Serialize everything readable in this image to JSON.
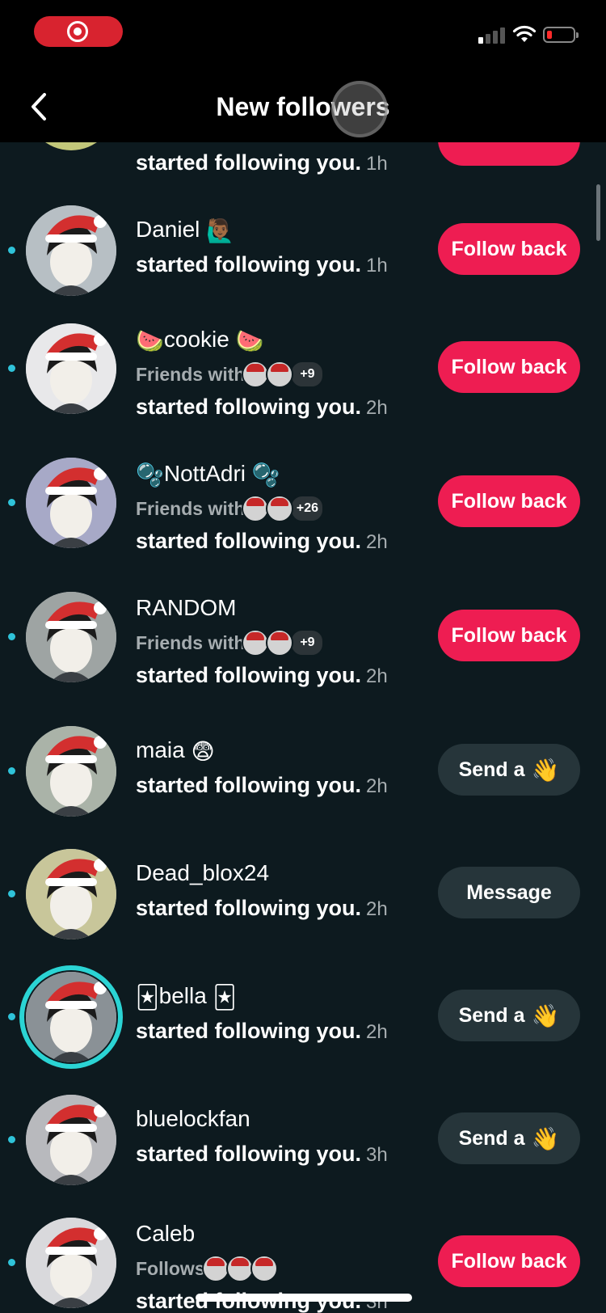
{
  "header": {
    "title": "New followers"
  },
  "partial_top": {
    "action": "started following you.",
    "time": "1h"
  },
  "rows": [
    {
      "name": "Daniel",
      "name_emoji_after": "🙋🏾‍♂️",
      "friends": null,
      "action": "started following you.",
      "time": "1h",
      "button": "Follow back",
      "button_style": "pink"
    },
    {
      "name": "cookie",
      "name_emoji_before": "🍉",
      "name_emoji_after": "🍉",
      "friends": {
        "label": "Friends with",
        "more": "+9"
      },
      "action": "started following you.",
      "time": "2h",
      "button": "Follow back",
      "button_style": "pink"
    },
    {
      "name": "NottAdri",
      "name_emoji_before": "🫧",
      "name_emoji_after": "🫧",
      "friends": {
        "label": "Friends with",
        "more": "+26"
      },
      "action": "started following you.",
      "time": "2h",
      "button": "Follow back",
      "button_style": "pink"
    },
    {
      "name": "RANDOM",
      "friends": {
        "label": "Friends with",
        "more": "+9"
      },
      "action": "started following you.",
      "time": "2h",
      "button": "Follow back",
      "button_style": "pink"
    },
    {
      "name": "maia",
      "name_emoji_after": "😨",
      "friends": null,
      "action": "started following you.",
      "time": "2h",
      "button": "Send a",
      "button_emoji": "👋",
      "button_style": "dark"
    },
    {
      "name": "Dead_blox24",
      "friends": null,
      "action": "started following you.",
      "time": "2h",
      "button": "Message",
      "button_style": "dark"
    },
    {
      "name": "bella",
      "name_emoji_before": "🃏",
      "name_emoji_after": "🃏",
      "friends": null,
      "action": "started following you.",
      "time": "2h",
      "button": "Send a",
      "button_emoji": "👋",
      "button_style": "dark",
      "story_ring": true
    },
    {
      "name": "bluelockfan",
      "friends": null,
      "action": "started following you.",
      "time": "3h",
      "button": "Send a",
      "button_emoji": "👋",
      "button_style": "dark"
    },
    {
      "name": "Caleb",
      "friends": {
        "label": "Follows",
        "more": ""
      },
      "action": "started following you.",
      "time": "3h",
      "button": "Follow back",
      "button_style": "pink"
    }
  ],
  "colors": {
    "pink": "#ee1d52",
    "dark_button": "#26353a",
    "background": "#0d1a1f",
    "unread": "#2fc3d9",
    "story_ring": "#2bd4d4"
  },
  "icons": {
    "back": "chevron-left-icon",
    "record": "screen-record-icon",
    "wifi": "wifi-icon",
    "battery": "battery-low-icon",
    "signal": "cellular-signal-icon"
  }
}
